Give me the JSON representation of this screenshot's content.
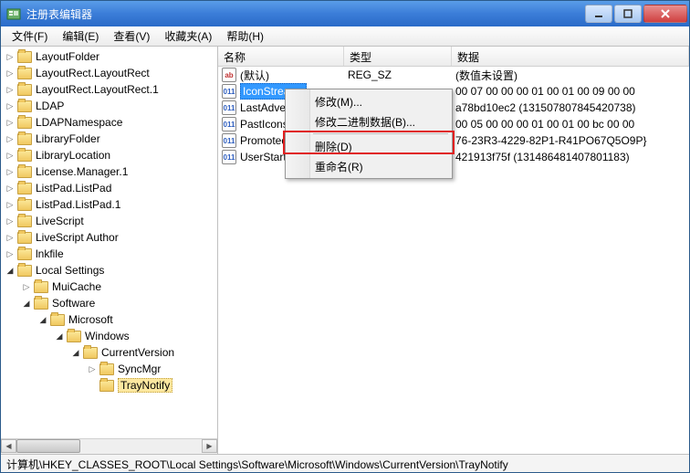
{
  "window": {
    "title": "注册表编辑器"
  },
  "menu": {
    "file": "文件(F)",
    "edit": "编辑(E)",
    "view": "查看(V)",
    "fav": "收藏夹(A)",
    "help": "帮助(H)"
  },
  "tree": [
    {
      "d": 0,
      "exp": "▷",
      "label": "LayoutFolder"
    },
    {
      "d": 0,
      "exp": "▷",
      "label": "LayoutRect.LayoutRect"
    },
    {
      "d": 0,
      "exp": "▷",
      "label": "LayoutRect.LayoutRect.1"
    },
    {
      "d": 0,
      "exp": "▷",
      "label": "LDAP"
    },
    {
      "d": 0,
      "exp": "▷",
      "label": "LDAPNamespace"
    },
    {
      "d": 0,
      "exp": "▷",
      "label": "LibraryFolder"
    },
    {
      "d": 0,
      "exp": "▷",
      "label": "LibraryLocation"
    },
    {
      "d": 0,
      "exp": "▷",
      "label": "License.Manager.1"
    },
    {
      "d": 0,
      "exp": "▷",
      "label": "ListPad.ListPad"
    },
    {
      "d": 0,
      "exp": "▷",
      "label": "ListPad.ListPad.1"
    },
    {
      "d": 0,
      "exp": "▷",
      "label": "LiveScript"
    },
    {
      "d": 0,
      "exp": "▷",
      "label": "LiveScript Author"
    },
    {
      "d": 0,
      "exp": "▷",
      "label": "lnkfile"
    },
    {
      "d": 0,
      "exp": "◢",
      "label": "Local Settings",
      "open": true
    },
    {
      "d": 1,
      "exp": "▷",
      "label": "MuiCache"
    },
    {
      "d": 1,
      "exp": "◢",
      "label": "Software",
      "open": true
    },
    {
      "d": 2,
      "exp": "◢",
      "label": "Microsoft",
      "open": true
    },
    {
      "d": 3,
      "exp": "◢",
      "label": "Windows",
      "open": true
    },
    {
      "d": 4,
      "exp": "◢",
      "label": "CurrentVersion",
      "open": true,
      "clip": true
    },
    {
      "d": 5,
      "exp": "▷",
      "label": "SyncMgr"
    },
    {
      "d": 5,
      "exp": "",
      "label": "TrayNotify",
      "sel": true
    }
  ],
  "columns": {
    "name": "名称",
    "type": "类型",
    "data": "数据"
  },
  "rows": [
    {
      "icon": "str",
      "name": "(默认)",
      "type": "REG_SZ",
      "data": "(数值未设置)"
    },
    {
      "icon": "bin",
      "name": "IconStreams",
      "type": "",
      "data": "   00 07 00 00 00 01 00 01 00 09 00 00",
      "sel": true
    },
    {
      "icon": "bin",
      "name": "LastAdvertise",
      "type": "",
      "data": "a78bd10ec2 (131507807845420738)"
    },
    {
      "icon": "bin",
      "name": "PastIconsStre",
      "type": "",
      "data": "   00 05 00 00 00 01 00 01 00 bc 00 00"
    },
    {
      "icon": "bin",
      "name": "PromotedIco",
      "type": "",
      "data": "76-23R3-4229-82P1-R41PO67Q5O9P}"
    },
    {
      "icon": "bin",
      "name": "UserStartTim",
      "type": "",
      "data": "421913f75f (131486481407801183)"
    }
  ],
  "context_menu": {
    "modify": "修改(M)...",
    "modify_bin": "修改二进制数据(B)...",
    "delete": "删除(D)",
    "rename": "重命名(R)"
  },
  "statusbar": "计算机\\HKEY_CLASSES_ROOT\\Local Settings\\Software\\Microsoft\\Windows\\CurrentVersion\\TrayNotify"
}
